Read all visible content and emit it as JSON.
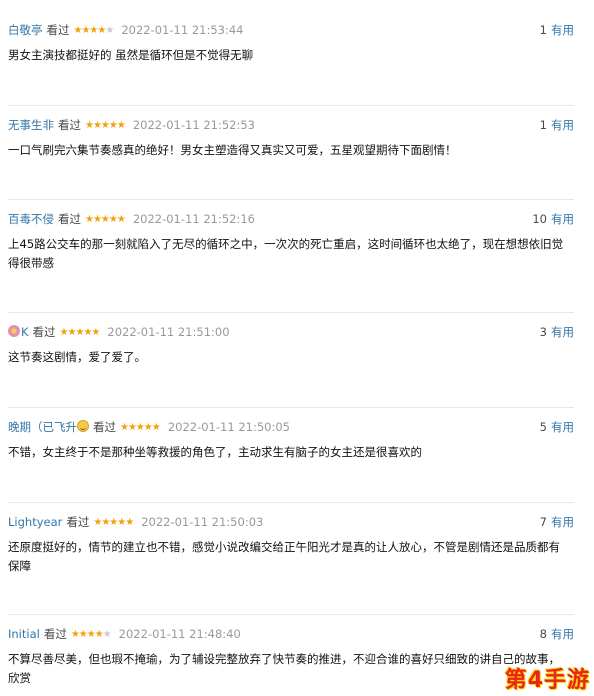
{
  "reviews": [
    {
      "user": "白敬亭",
      "watched": "看过",
      "stars": "★★★★",
      "stars_off": "★",
      "time": "2022-01-11 21:53:44",
      "votes": "1",
      "useful_label": "有用",
      "content": "男女主演技都挺好的 虽然是循环但是不觉得无聊"
    },
    {
      "user": "无事生非",
      "watched": "看过",
      "stars": "★★★★★",
      "stars_off": "",
      "time": "2022-01-11 21:52:53",
      "votes": "1",
      "useful_label": "有用",
      "content": "一口气刷完六集节奏感真的绝好！男女主塑造得又真实又可爱，五星观望期待下面剧情！"
    },
    {
      "user": "百毒不侵",
      "watched": "看过",
      "stars": "★★★★★",
      "stars_off": "",
      "time": "2022-01-11 21:52:16",
      "votes": "10",
      "useful_label": "有用",
      "content": "上45路公交车的那一刻就陷入了无尽的循环之中，一次次的死亡重启，这时间循环也太绝了，现在想想依旧觉得很带感"
    },
    {
      "user": "K",
      "watched": "看过",
      "stars": "★★★★★",
      "stars_off": "",
      "time": "2022-01-11 21:51:00",
      "votes": "3",
      "useful_label": "有用",
      "content": "这节奏这剧情，爱了爱了。"
    },
    {
      "user": "晚期（已飞升",
      "watched": "看过",
      "stars": "★★★★★",
      "stars_off": "",
      "time": "2022-01-11 21:50:05",
      "votes": "5",
      "useful_label": "有用",
      "content": "不错，女主终于不是那种坐等救援的角色了，主动求生有脑子的女主还是很喜欢的"
    },
    {
      "user": "Lightyear",
      "watched": "看过",
      "stars": "★★★★★",
      "stars_off": "",
      "time": "2022-01-11 21:50:03",
      "votes": "7",
      "useful_label": "有用",
      "content": "还原度挺好的，情节的建立也不错，感觉小说改编交给正午阳光才是真的让人放心，不管是剧情还是品质都有保障"
    },
    {
      "user": "Initial",
      "watched": "看过",
      "stars": "★★★★",
      "stars_off": "★",
      "time": "2022-01-11 21:48:40",
      "votes": "8",
      "useful_label": "有用",
      "content": "不算尽善尽美，但也瑕不掩瑜，为了辅设完整放弃了快节奏的推进，不迎合谁的喜好只细致的讲自己的故事，欣赏"
    }
  ],
  "watermark": "第4手游",
  "colors": {
    "link": "#3377aa",
    "star": "#f3a20c",
    "time": "#999999",
    "watermark": "#e8241b"
  }
}
